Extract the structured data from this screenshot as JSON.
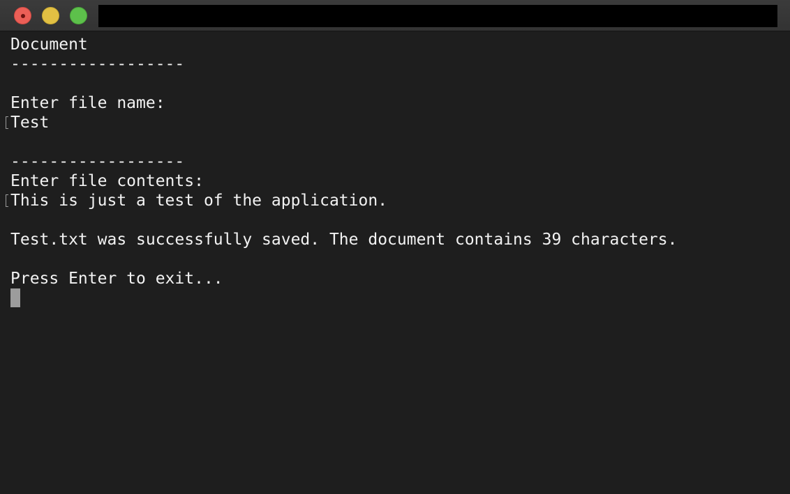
{
  "window": {
    "title": ""
  },
  "terminal": {
    "lines": [
      "Document",
      "------------------",
      "",
      "Enter file name:",
      "Test",
      "",
      "------------------",
      "Enter file contents:",
      "This is just a test of the application.",
      "",
      "Test.txt was successfully saved. The document contains 39 characters.",
      "",
      "Press Enter to exit..."
    ]
  },
  "colors": {
    "background": "#1e1e1e",
    "text": "#f2f2f2",
    "cursor": "#9c9c9c",
    "titlebar": "#363636",
    "close_button": "#ec5f57",
    "minimize_button": "#e2c043",
    "zoom_button": "#5dc04b"
  }
}
